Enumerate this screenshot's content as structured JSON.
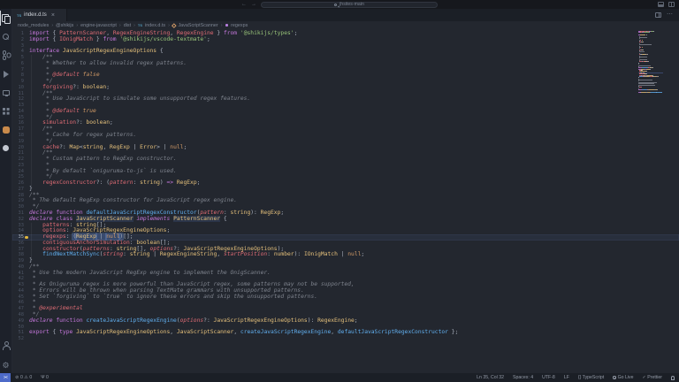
{
  "window": {
    "search_text": "jhsites-main"
  },
  "titlebar": {
    "back": "←",
    "forward": "→"
  },
  "activity_bar": {
    "top": [
      {
        "name": "explorer",
        "active": true
      },
      {
        "name": "search"
      },
      {
        "name": "source-control"
      },
      {
        "name": "run-debug"
      },
      {
        "name": "remote"
      },
      {
        "name": "extensions"
      },
      {
        "name": "ext-orange"
      },
      {
        "name": "ext-circle"
      }
    ],
    "bottom": [
      {
        "name": "account"
      },
      {
        "name": "settings"
      }
    ]
  },
  "editor_tab": {
    "icon": "TS",
    "label": "index.d.ts",
    "close": "×"
  },
  "editor_actions": {
    "more": "⋯"
  },
  "breadcrumb": {
    "separator": "›",
    "items": [
      {
        "label": "node_modules"
      },
      {
        "label": "@shikijs"
      },
      {
        "label": "engine-javascript"
      },
      {
        "label": "dist"
      },
      {
        "label": "index.d.ts",
        "icon": "ts"
      },
      {
        "label": "JavaScriptScanner",
        "icon": "class"
      },
      {
        "label": "regexps",
        "icon": "field"
      }
    ]
  },
  "theme": {
    "accent": "#4d6ac8",
    "editor_bg": "#23272f",
    "chrome_bg": "#1b1f26",
    "keyword": "#c678dd",
    "type": "#e5c07b",
    "string": "#98c379",
    "comment": "#7f848e",
    "variable": "#e06c75",
    "function": "#61afef",
    "constant": "#d19a66"
  },
  "editor": {
    "current_line": 35,
    "lightbulb_line": 35,
    "indent_guides": [
      {
        "from": 5,
        "to": 26
      },
      {
        "from": 33,
        "to": 38
      }
    ],
    "lines": [
      [
        [
          "kw",
          "import "
        ],
        [
          "p",
          "{ "
        ],
        [
          "red",
          "PatternScanner"
        ],
        [
          "p",
          ", "
        ],
        [
          "red",
          "RegexEngineString"
        ],
        [
          "p",
          ", "
        ],
        [
          "red",
          "RegexEngine"
        ],
        [
          "p",
          " } "
        ],
        [
          "kw",
          "from "
        ],
        [
          "str",
          "'@shikijs/types'"
        ],
        [
          "p",
          ";"
        ]
      ],
      [
        [
          "kw",
          "import "
        ],
        [
          "p",
          "{ "
        ],
        [
          "red",
          "IOnigMatch"
        ],
        [
          "p",
          " } "
        ],
        [
          "kw",
          "from "
        ],
        [
          "str",
          "'@shikijs/vscode-textmate'"
        ],
        [
          "p",
          ";"
        ]
      ],
      [],
      [
        [
          "kw",
          "interface "
        ],
        [
          "typ",
          "JavaScriptRegexEngineOptions"
        ],
        [
          "p",
          " {"
        ]
      ],
      [
        [
          "com",
          "    /**"
        ]
      ],
      [
        [
          "com",
          "     * Whether to allow invalid regex patterns."
        ]
      ],
      [
        [
          "com",
          "     *"
        ]
      ],
      [
        [
          "com",
          "     * "
        ],
        [
          "doc",
          "@default"
        ],
        [
          "consti",
          " false"
        ]
      ],
      [
        [
          "com",
          "     */"
        ]
      ],
      [
        [
          "p",
          "    "
        ],
        [
          "red",
          "forgiving"
        ],
        [
          "p",
          "?: "
        ],
        [
          "typ",
          "boolean"
        ],
        [
          "p",
          ";"
        ]
      ],
      [
        [
          "com",
          "    /**"
        ]
      ],
      [
        [
          "com",
          "     * Use JavaScript to simulate some unsupported regex features."
        ]
      ],
      [
        [
          "com",
          "     *"
        ]
      ],
      [
        [
          "com",
          "     * "
        ],
        [
          "doc",
          "@default"
        ],
        [
          "consti",
          " true"
        ]
      ],
      [
        [
          "com",
          "     */"
        ]
      ],
      [
        [
          "p",
          "    "
        ],
        [
          "red",
          "simulation"
        ],
        [
          "p",
          "?: "
        ],
        [
          "typ",
          "boolean"
        ],
        [
          "p",
          ";"
        ]
      ],
      [
        [
          "com",
          "    /**"
        ]
      ],
      [
        [
          "com",
          "     * Cache for regex patterns."
        ]
      ],
      [
        [
          "com",
          "     */"
        ]
      ],
      [
        [
          "p",
          "    "
        ],
        [
          "red",
          "cache"
        ],
        [
          "p",
          "?: "
        ],
        [
          "typ",
          "Map"
        ],
        [
          "p",
          "<"
        ],
        [
          "typ",
          "string"
        ],
        [
          "p",
          ", "
        ],
        [
          "typ",
          "RegExp"
        ],
        [
          "p",
          " | "
        ],
        [
          "typ",
          "Error"
        ],
        [
          "p",
          "> | "
        ],
        [
          "const",
          "null"
        ],
        [
          "p",
          ";"
        ]
      ],
      [
        [
          "com",
          "    /**"
        ]
      ],
      [
        [
          "com",
          "     * Custom pattern to RegExp constructor."
        ]
      ],
      [
        [
          "com",
          "     *"
        ]
      ],
      [
        [
          "com",
          "     * By default `oniguruma-to-js` is used."
        ]
      ],
      [
        [
          "com",
          "     */"
        ]
      ],
      [
        [
          "p",
          "    "
        ],
        [
          "red",
          "regexConstructor"
        ],
        [
          "p",
          "?: ("
        ],
        [
          "redi",
          "pattern"
        ],
        [
          "p",
          ": "
        ],
        [
          "typ",
          "string"
        ],
        [
          "p",
          ") "
        ],
        [
          "kw",
          "=> "
        ],
        [
          "typ",
          "RegExp"
        ],
        [
          "p",
          ";"
        ]
      ],
      [
        [
          "p",
          "}"
        ]
      ],
      [
        [
          "com",
          "/**"
        ]
      ],
      [
        [
          "com",
          " * The default RegExp constructor for JavaScript regex engine."
        ]
      ],
      [
        [
          "com",
          " */"
        ]
      ],
      [
        [
          "kwi",
          "declare "
        ],
        [
          "kw",
          "function "
        ],
        [
          "fn",
          "defaultJavaScriptRegexConstructor"
        ],
        [
          "p",
          "("
        ],
        [
          "redi",
          "pattern"
        ],
        [
          "p",
          ": "
        ],
        [
          "typ",
          "string"
        ],
        [
          "p",
          "): "
        ],
        [
          "typ",
          "RegExp"
        ],
        [
          "p",
          ";"
        ]
      ],
      [
        [
          "kwi",
          "declare "
        ],
        [
          "kw",
          "class "
        ],
        [
          "typ ul",
          "JavaScriptScanner"
        ],
        [
          "p",
          " "
        ],
        [
          "kwi",
          "implements"
        ],
        [
          "p",
          " "
        ],
        [
          "typ ul",
          "PatternScanner"
        ],
        [
          "p",
          " {"
        ]
      ],
      [
        [
          "p",
          "    "
        ],
        [
          "red",
          "patterns"
        ],
        [
          "p",
          ": "
        ],
        [
          "typ",
          "string"
        ],
        [
          "p",
          "[];"
        ]
      ],
      [
        [
          "p",
          "    "
        ],
        [
          "red",
          "options"
        ],
        [
          "p",
          ": "
        ],
        [
          "typ",
          "JavaScriptRegexEngineOptions"
        ],
        [
          "p",
          ";"
        ]
      ],
      [
        [
          "p",
          "    "
        ],
        [
          "red",
          "regexps"
        ],
        [
          "p",
          ": "
        ],
        [
          "p hl",
          "("
        ],
        [
          "typ hl",
          "RegExp"
        ],
        [
          "p hl",
          " | "
        ],
        [
          "const hl",
          "null"
        ],
        [
          "p hl",
          ")"
        ],
        [
          "p",
          "[];"
        ]
      ],
      [
        [
          "p",
          "    "
        ],
        [
          "red",
          "contiguousAnchorSimulation"
        ],
        [
          "p",
          ": "
        ],
        [
          "typ",
          "boolean"
        ],
        [
          "p",
          "[];"
        ]
      ],
      [
        [
          "p",
          "    "
        ],
        [
          "red",
          "constructor"
        ],
        [
          "p",
          "("
        ],
        [
          "redi",
          "patterns"
        ],
        [
          "p",
          ": "
        ],
        [
          "typ",
          "string"
        ],
        [
          "p",
          "[], "
        ],
        [
          "redi",
          "options"
        ],
        [
          "p",
          "?: "
        ],
        [
          "typ",
          "JavaScriptRegexEngineOptions"
        ],
        [
          "p",
          ");"
        ]
      ],
      [
        [
          "p",
          "    "
        ],
        [
          "fn",
          "findNextMatchSync"
        ],
        [
          "p",
          "("
        ],
        [
          "redi",
          "string"
        ],
        [
          "p",
          ": "
        ],
        [
          "typ",
          "string"
        ],
        [
          "p",
          " | "
        ],
        [
          "typ",
          "RegexEngineString"
        ],
        [
          "p",
          ", "
        ],
        [
          "redi",
          "startPosition"
        ],
        [
          "p",
          ": "
        ],
        [
          "typ",
          "number"
        ],
        [
          "p",
          "): "
        ],
        [
          "typ",
          "IOnigMatch"
        ],
        [
          "p",
          " | "
        ],
        [
          "const",
          "null"
        ],
        [
          "p",
          ";"
        ]
      ],
      [
        [
          "p",
          "}"
        ]
      ],
      [
        [
          "com",
          "/**"
        ]
      ],
      [
        [
          "com",
          " * Use the modern JavaScript RegExp engine to implement the OnigScanner."
        ]
      ],
      [
        [
          "com",
          " *"
        ]
      ],
      [
        [
          "com",
          " * As Oniguruma regex is more powerful than JavaScript regex, some patterns may not be supported,"
        ]
      ],
      [
        [
          "com",
          " * Errors will be thrown when parsing TextMate grammars with unsupported patterns."
        ]
      ],
      [
        [
          "com",
          " * Set `forgiving` to `true` to ignore these errors and skip the unsupported patterns."
        ]
      ],
      [
        [
          "com",
          " *"
        ]
      ],
      [
        [
          "com",
          " * "
        ],
        [
          "doc",
          "@experimental"
        ]
      ],
      [
        [
          "com",
          " */"
        ]
      ],
      [
        [
          "kwi",
          "declare "
        ],
        [
          "kw",
          "function "
        ],
        [
          "fn",
          "createJavaScriptRegexEngine"
        ],
        [
          "p",
          "("
        ],
        [
          "redi",
          "options"
        ],
        [
          "p",
          "?: "
        ],
        [
          "typ",
          "JavaScriptRegexEngineOptions"
        ],
        [
          "p",
          "): "
        ],
        [
          "typ",
          "RegexEngine"
        ],
        [
          "p",
          ";"
        ]
      ],
      [],
      [
        [
          "kw",
          "export "
        ],
        [
          "p",
          "{ "
        ],
        [
          "kw",
          "type "
        ],
        [
          "typ",
          "JavaScriptRegexEngineOptions"
        ],
        [
          "p",
          ", "
        ],
        [
          "typ",
          "JavaScriptScanner"
        ],
        [
          "p",
          ", "
        ],
        [
          "fn",
          "createJavaScriptRegexEngine"
        ],
        [
          "p",
          ", "
        ],
        [
          "fn",
          "defaultJavaScriptRegexConstructor"
        ],
        [
          "p",
          " };"
        ]
      ],
      []
    ]
  },
  "status_bar": {
    "left": [
      {
        "name": "remote",
        "icon": "remote",
        "label": "",
        "accent": true
      },
      {
        "name": "problems",
        "label": "⊘ 0  ⚠ 0"
      },
      {
        "name": "ports",
        "label": "Ψ 0"
      }
    ],
    "right": [
      {
        "name": "cursor-position",
        "label": "Ln 35, Col 32"
      },
      {
        "name": "indentation",
        "label": "Spaces: 4"
      },
      {
        "name": "encoding",
        "label": "UTF-8"
      },
      {
        "name": "eol",
        "label": "LF"
      },
      {
        "name": "language-mode",
        "label": "{} TypeScript"
      },
      {
        "name": "go-live",
        "icon": "broadcast",
        "label": "Go Live"
      },
      {
        "name": "prettier",
        "label": "✓ Prettier"
      },
      {
        "name": "notifications",
        "icon": "bell",
        "label": ""
      }
    ]
  }
}
